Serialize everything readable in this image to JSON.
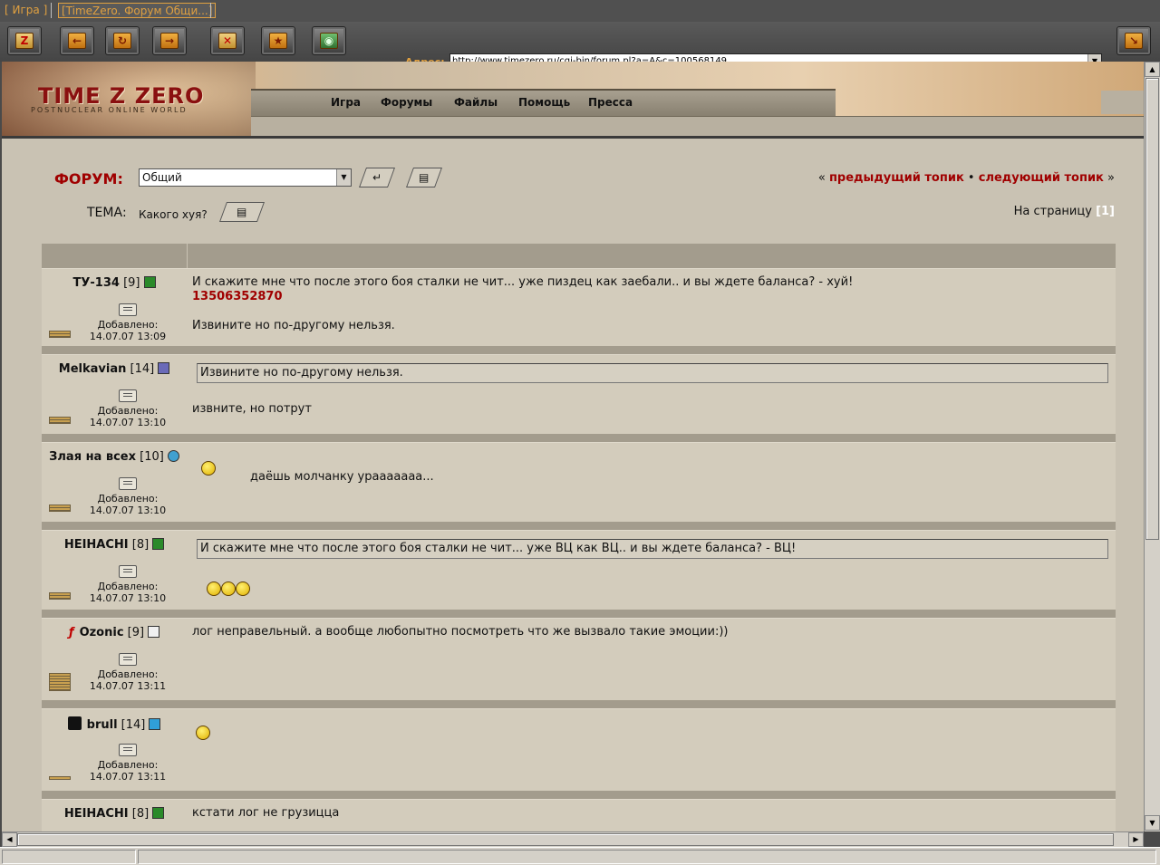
{
  "tabs": [
    {
      "label": "[ Игра ]"
    },
    {
      "label": "[TimeZero. Форум Общи...]"
    }
  ],
  "toolbar": {
    "address_label": "Адрес:",
    "address": "http://www.timezero.ru/cgi-bin/forum.pl?a=A&c=100568149"
  },
  "banner": {
    "logo": "TIME Z ZERO",
    "logo_sub": "POSTNUCLEAR  ONLINE WORLD",
    "nav": [
      "Игра",
      "Форумы",
      "Файлы",
      "Помощь",
      "Пресса"
    ]
  },
  "forum": {
    "label": "ФОРУМ:",
    "selected": "Общий",
    "prev": "предыдущий топик",
    "next": "следующий топик",
    "open_quote": "«",
    "bullet": "•",
    "close_quote": "»",
    "topic_label": "ТЕМА:",
    "topic": "Какого хуя?",
    "pages_label": "На страницу",
    "page": "[1]"
  },
  "posts": [
    {
      "author": "ТУ-134",
      "level": "[9]",
      "added": "Добавлено:",
      "date": "14.07.07 13:09",
      "line1": "И скажите мне что после этого боя сталки не чит...  уже пиздец как заебали.. и вы ждете баланса? - хуй!",
      "line2": "13506352870",
      "line3": "Извините но по-другому нельзя."
    },
    {
      "author": "Melkavian",
      "level": "[14]",
      "added": "Добавлено:",
      "date": "14.07.07 13:10",
      "quote": "Извините но по-другому нельзя.",
      "text": "извните, но потрут"
    },
    {
      "author": "Злая на всех",
      "level": "[10]",
      "added": "Добавлено:",
      "date": "14.07.07 13:10",
      "text": "даёшь молчанку урааааааа..."
    },
    {
      "author": "HEIHACHI",
      "level": "[8]",
      "added": "Добавлено:",
      "date": "14.07.07 13:10",
      "quote": "И скажите мне что после этого боя сталки не чит...  уже ВЦ как ВЦ.. и вы ждете баланса? - ВЦ!"
    },
    {
      "author": "Ozonic",
      "level": "[9]",
      "added": "Добавлено:",
      "date": "14.07.07 13:11",
      "text": "лог неправельный. а вообще любопытно посмотреть что же вызвало такие эмоции:))"
    },
    {
      "author": "brull",
      "level": "[14]",
      "added": "Добавлено:",
      "date": "14.07.07 13:11"
    },
    {
      "author": "HEIHACHI",
      "level": "[8]",
      "text": "кстати лог не грузицца"
    }
  ]
}
